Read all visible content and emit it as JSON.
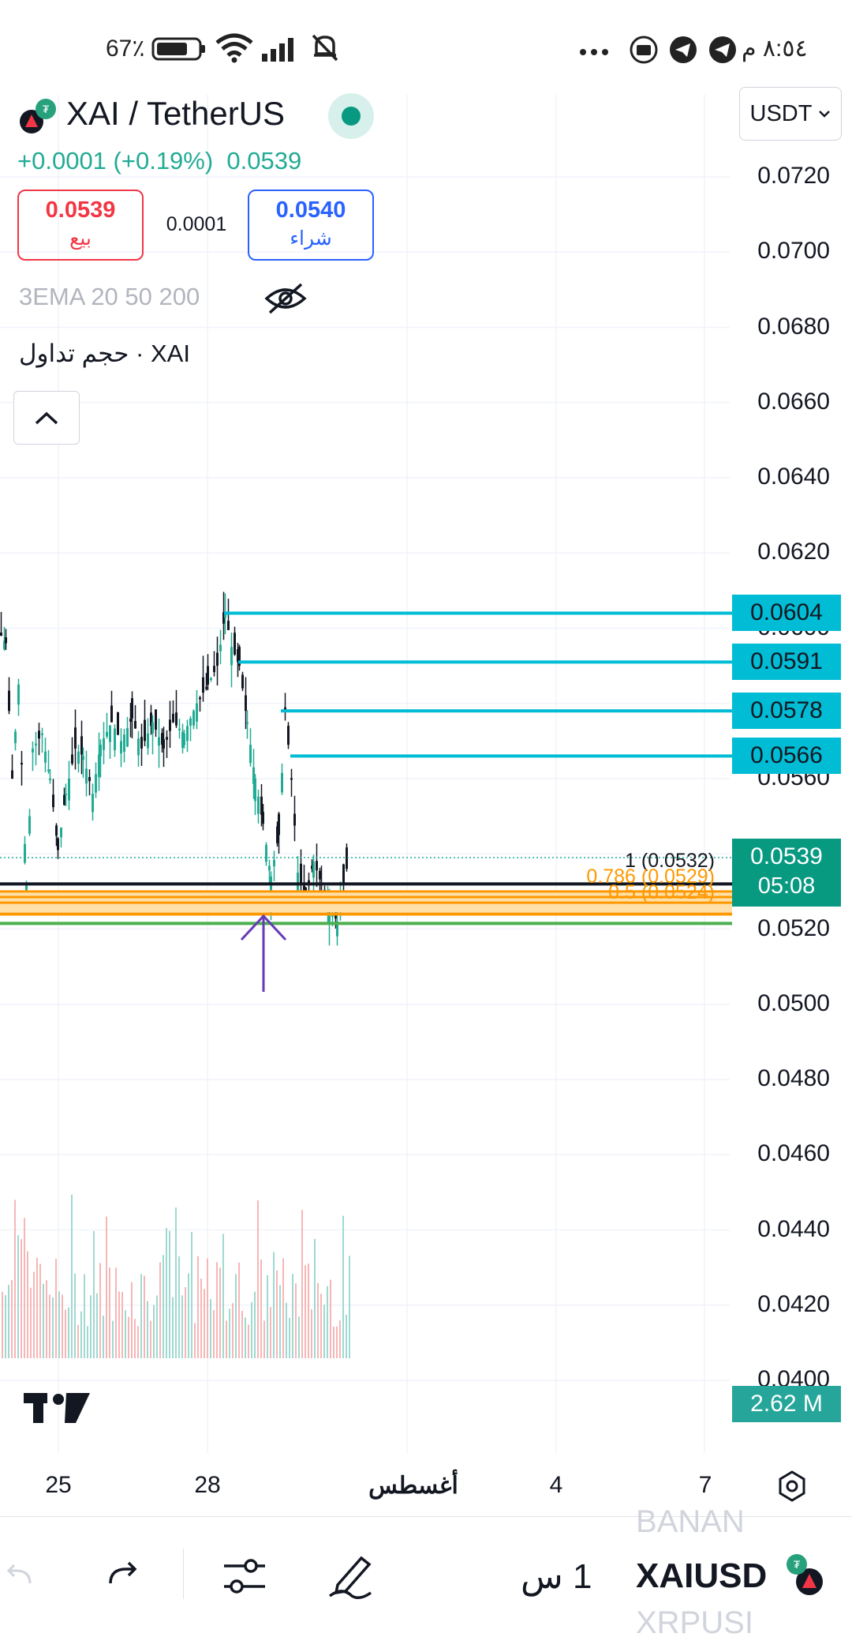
{
  "status_bar": {
    "time": "٨:٥٤ م",
    "battery": "67٪"
  },
  "header": {
    "symbol_title": "XAI / TetherUS",
    "change": "+0.0001 (+0.19%)",
    "last_price": "0.0539",
    "bid_price": "0.0539",
    "bid_label": "بيع",
    "spread": "0.0001",
    "ask_price": "0.0540",
    "ask_label": "شراء",
    "indicator_label": "3EMA 20 50 200",
    "volume_label": "حجم تداول · XAI",
    "currency": "USDT"
  },
  "colors": {
    "up": "#22ab94",
    "down": "#f23645",
    "accent": "#2962ff",
    "level_line": "#00bcd4",
    "fib_orange": "#ff9800",
    "fib_green": "#4caf50",
    "arrow": "#673ab7"
  },
  "chart": {
    "price_ticks": [
      "0.0720",
      "0.0700",
      "0.0680",
      "0.0660",
      "0.0640",
      "0.0620",
      "0.0600",
      "0.0580",
      "0.0560",
      "0.0540",
      "0.0520",
      "0.0500",
      "0.0480",
      "0.0460",
      "0.0440",
      "0.0420",
      "0.0400"
    ],
    "level_tags": [
      "0.0604",
      "0.0591",
      "0.0578",
      "0.0566"
    ],
    "current_price": "0.0539",
    "countdown": "05:08",
    "volume_value": "2.62 M",
    "fib_label_1": "1 (0.0532)",
    "fib_label_2": "0.5 (0.0524)",
    "fib_label_3": "0.786 (0.0529)",
    "date_ticks": [
      "25",
      "28",
      "أغسطس",
      "4",
      "7"
    ]
  },
  "chart_data": {
    "type": "candlestick",
    "price_axis_range": [
      0.0395,
      0.073
    ],
    "horizontal_levels": [
      0.0604,
      0.0591,
      0.0578,
      0.0566
    ],
    "fib_levels": [
      {
        "label": "1",
        "value": 0.0532
      },
      {
        "label": "0.786",
        "value": 0.0529
      },
      {
        "label": "0.5",
        "value": 0.0524
      }
    ],
    "last_price": 0.0539,
    "x_ticks": [
      "25",
      "28",
      "أغسطس",
      "4",
      "7"
    ]
  },
  "bottom": {
    "interval": "1 س",
    "symbol": "XAIUSD",
    "symbol_above": "BANAN",
    "symbol_below": "XRPUSI"
  }
}
